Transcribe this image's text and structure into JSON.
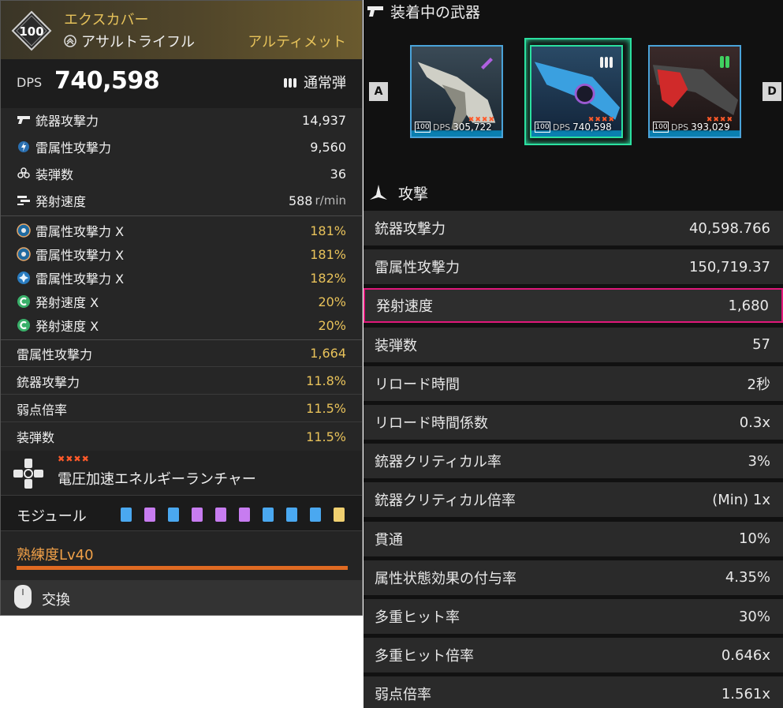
{
  "weapon": {
    "level": "100",
    "name": "エクスカバー",
    "type": "アサルトライフル",
    "rarity": "アルティメット",
    "dps_label": "DPS",
    "dps_value": "740,598",
    "ammo_type": "通常弾"
  },
  "stats": [
    {
      "icon": "pistol-icon",
      "label": "銃器攻撃力",
      "value": "14,937",
      "unit": ""
    },
    {
      "icon": "lightning-icon",
      "label": "雷属性攻撃力",
      "value": "9,560",
      "unit": ""
    },
    {
      "icon": "magazine-icon",
      "label": "装弾数",
      "value": "36",
      "unit": ""
    },
    {
      "icon": "firerate-icon",
      "label": "発射速度",
      "value": "588",
      "unit": "r/min"
    }
  ],
  "substats": [
    {
      "icon": "core-ring-icon",
      "label": "雷属性攻撃力 X",
      "value": "181%"
    },
    {
      "icon": "core-ring-icon",
      "label": "雷属性攻撃力 X",
      "value": "181%"
    },
    {
      "icon": "core-star-icon",
      "label": "雷属性攻撃力 X",
      "value": "182%"
    },
    {
      "icon": "green-c-icon",
      "label": "発射速度 X",
      "value": "20%"
    },
    {
      "icon": "green-c-icon",
      "label": "発射速度 X",
      "value": "20%"
    }
  ],
  "bonuses": [
    {
      "label": "雷属性攻撃力",
      "value": "1,664"
    },
    {
      "label": "銃器攻撃力",
      "value": "11.8%"
    },
    {
      "label": "弱点倍率",
      "value": "11.5%"
    },
    {
      "label": "装弾数",
      "value": "11.5%"
    }
  ],
  "module_skill": {
    "stars": "✖✖✖✖",
    "name": "電圧加速エネルギーランチャー"
  },
  "modules": {
    "label": "モジュール",
    "chips": [
      "#4aa8f0",
      "#c77cf0",
      "#4aa8f0",
      "#c77cf0",
      "#c77cf0",
      "#c77cf0",
      "#4aa8f0",
      "#4aa8f0",
      "#4aa8f0",
      "#f0d070"
    ]
  },
  "proficiency": {
    "label": "熟練度Lv40",
    "fill": 1.0
  },
  "swap": {
    "label": "交換"
  },
  "equipped": {
    "title": "装着中の武器",
    "slot_left": "A",
    "slot_right": "D",
    "cards": [
      {
        "level": "100",
        "dps_label": "DPS",
        "dps": "305,722",
        "stars": "✖✖✖✖",
        "ammo_color": "#b060e0"
      },
      {
        "level": "100",
        "dps_label": "DPS",
        "dps": "740,598",
        "stars": "✖✖✖✖",
        "ammo_color": "#f0f0f0"
      },
      {
        "level": "100",
        "dps_label": "DPS",
        "dps": "393,029",
        "stars": "✖✖✖✖",
        "ammo_color": "#40d060"
      }
    ]
  },
  "attack": {
    "title": "攻撃",
    "rows": [
      {
        "label": "銃器攻撃力",
        "value": "40,598.766"
      },
      {
        "label": "雷属性攻撃力",
        "value": "150,719.37"
      },
      {
        "label": "発射速度",
        "value": "1,680",
        "highlight": true
      },
      {
        "label": "装弾数",
        "value": "57"
      },
      {
        "label": "リロード時間",
        "value": "2秒"
      },
      {
        "label": "リロード時間係数",
        "value": "0.3x"
      },
      {
        "label": "銃器クリティカル率",
        "value": "3%"
      },
      {
        "label": "銃器クリティカル倍率",
        "value": "(Min) 1x"
      },
      {
        "label": "貫通",
        "value": "10%"
      },
      {
        "label": "属性状態効果の付与率",
        "value": "4.35%"
      },
      {
        "label": "多重ヒット率",
        "value": "30%"
      },
      {
        "label": "多重ヒット倍率",
        "value": "0.646x"
      },
      {
        "label": "弱点倍率",
        "value": "1.561x"
      }
    ]
  }
}
